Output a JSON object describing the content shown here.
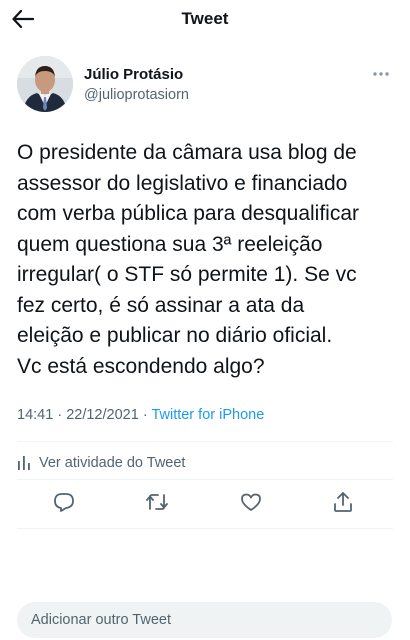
{
  "header": {
    "title": "Tweet"
  },
  "author": {
    "name": "Júlio Protásio",
    "handle": "@julioprotasiorn"
  },
  "tweet": {
    "text": "O presidente da câmara usa blog de\nassessor do legislativo e financiado\ncom verba pública para desqualificar\nquem questiona sua 3ª reeleição\nirregular( o STF só permite 1). Se vc\nfez certo, é só assinar a ata da\neleição e publicar no diário oficial.\nVc está escondendo algo?",
    "time": "14:41",
    "date": "22/12/2021",
    "separator": "·",
    "source": "Twitter for iPhone"
  },
  "activity": {
    "label": "Ver atividade do Tweet"
  },
  "reply": {
    "placeholder": "Adicionar outro Tweet"
  },
  "icons": {
    "back": "arrow-left-icon",
    "more": "more-dots-icon",
    "analytics": "bar-chart-icon",
    "reply": "speech-bubble-icon",
    "retweet": "retweet-arrows-icon",
    "like": "heart-icon",
    "share": "share-upload-icon"
  },
  "colors": {
    "text": "#0f1419",
    "secondary": "#536471",
    "link": "#1d9bf0",
    "divider": "#eff3f4"
  }
}
